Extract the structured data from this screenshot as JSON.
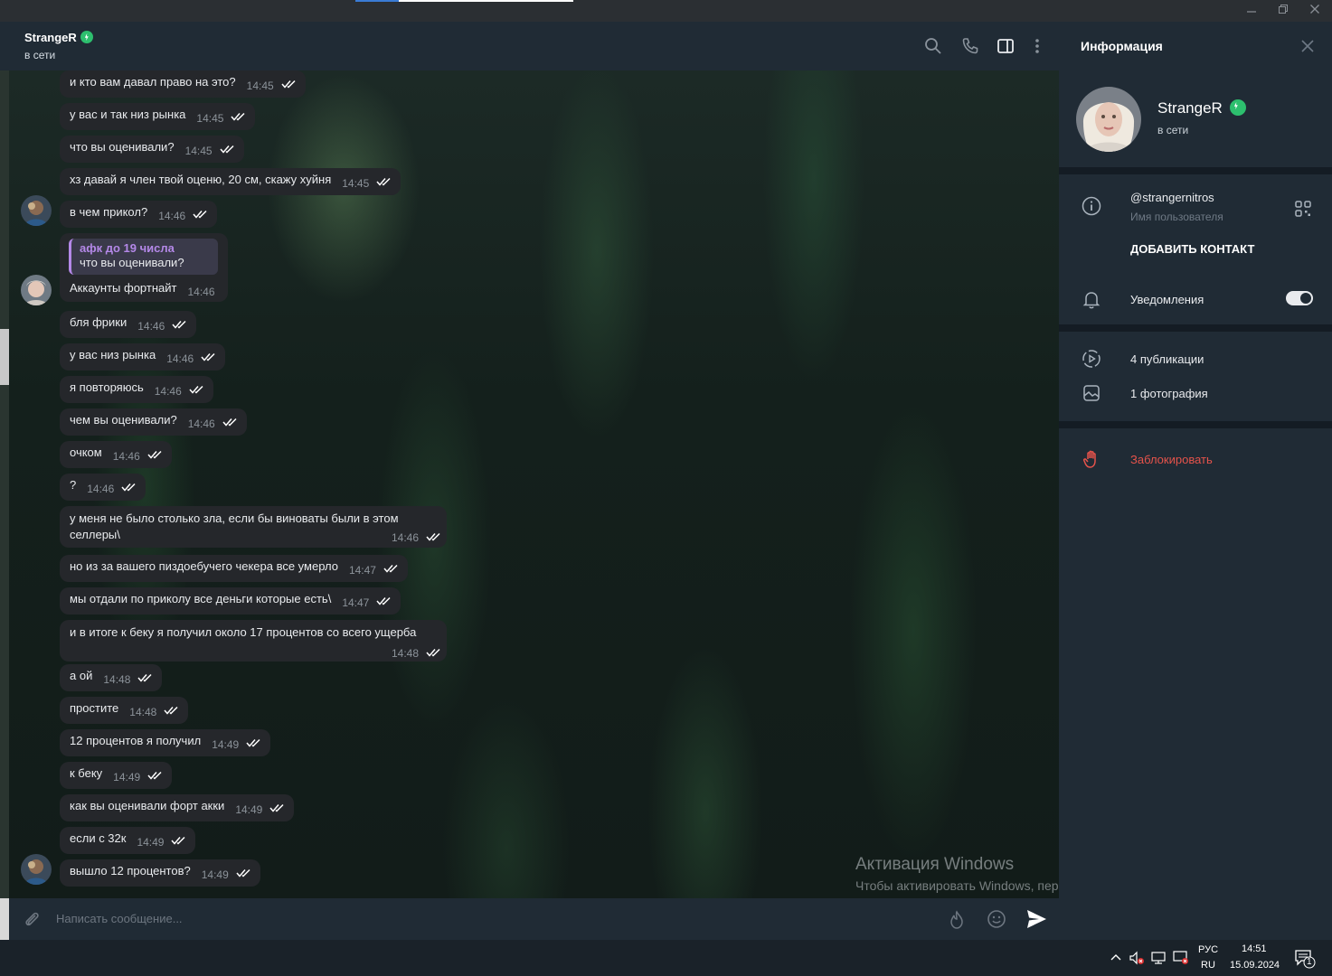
{
  "window": {
    "minimize_icon": "minimize-icon",
    "restore_icon": "restore-icon",
    "close_icon": "close-icon"
  },
  "chat_header": {
    "name": "StrangeR",
    "status": "в сети",
    "icons": [
      "search-icon",
      "phone-icon",
      "sidebar-toggle-icon",
      "more-icon"
    ]
  },
  "messages": [
    {
      "text": "и кто вам давал право на это?",
      "time": "14:45"
    },
    {
      "text": "у вас и так низ рынка",
      "time": "14:45"
    },
    {
      "text": "что вы оценивали?",
      "time": "14:45"
    },
    {
      "text": "хз давай я член твой оценю, 20 см, скажу хуйня",
      "time": "14:45"
    },
    {
      "text": "в чем прикол?",
      "time": "14:46"
    },
    {
      "text": "Аккаунты фортнайт",
      "time": "14:46",
      "reply_title": "афк до 19 числа",
      "reply_text": "что вы оценивали?"
    },
    {
      "text": "бля фрики",
      "time": "14:46"
    },
    {
      "text": "у вас низ рынка",
      "time": "14:46"
    },
    {
      "text": "я повторяюсь",
      "time": "14:46"
    },
    {
      "text": "чем вы оценивали?",
      "time": "14:46"
    },
    {
      "text": "очком",
      "time": "14:46"
    },
    {
      "text": "?",
      "time": "14:46"
    },
    {
      "text": "у меня не было столько зла, если бы виноваты были в этом селлеры\\",
      "time": "14:46"
    },
    {
      "text": "но из за вашего пиздоебучего чекера все умерло",
      "time": "14:47"
    },
    {
      "text": "мы отдали по приколу все деньги которые есть\\",
      "time": "14:47"
    },
    {
      "text": "и в итоге к беку я получил около 17 процентов со всего ущерба",
      "time": "14:48"
    },
    {
      "text": "а ой",
      "time": "14:48"
    },
    {
      "text": "простите",
      "time": "14:48"
    },
    {
      "text": "12 процентов я получил",
      "time": "14:49"
    },
    {
      "text": "к беку",
      "time": "14:49"
    },
    {
      "text": "как вы оценивали форт акки",
      "time": "14:49"
    },
    {
      "text": "если с 32к",
      "time": "14:49"
    },
    {
      "text": "вышло 12 процентов?",
      "time": "14:49"
    }
  ],
  "composer": {
    "placeholder": "Написать сообщение...",
    "icons": [
      "attach-icon",
      "boost-icon",
      "emoji-icon",
      "send-icon"
    ]
  },
  "watermark": {
    "title": "Активация Windows",
    "subtitle": "Чтобы активировать Windows, перейдите в раздел \"Параметры\"."
  },
  "info": {
    "title": "Информация",
    "name": "StrangeR",
    "status": "в сети",
    "username": "@strangernitros",
    "username_caption": "Имя пользователя",
    "add_contact": "ДОБАВИТЬ КОНТАКТ",
    "notifications": "Уведомления",
    "notifications_on": true,
    "posts": "4 публикации",
    "photos": "1 фотография",
    "block": "Заблокировать",
    "block_color": "#e5534b"
  },
  "taskbar": {
    "lang_top": "РУС",
    "lang_bottom": "RU",
    "time": "14:51",
    "date": "15.09.2024",
    "notification_count": "1"
  }
}
